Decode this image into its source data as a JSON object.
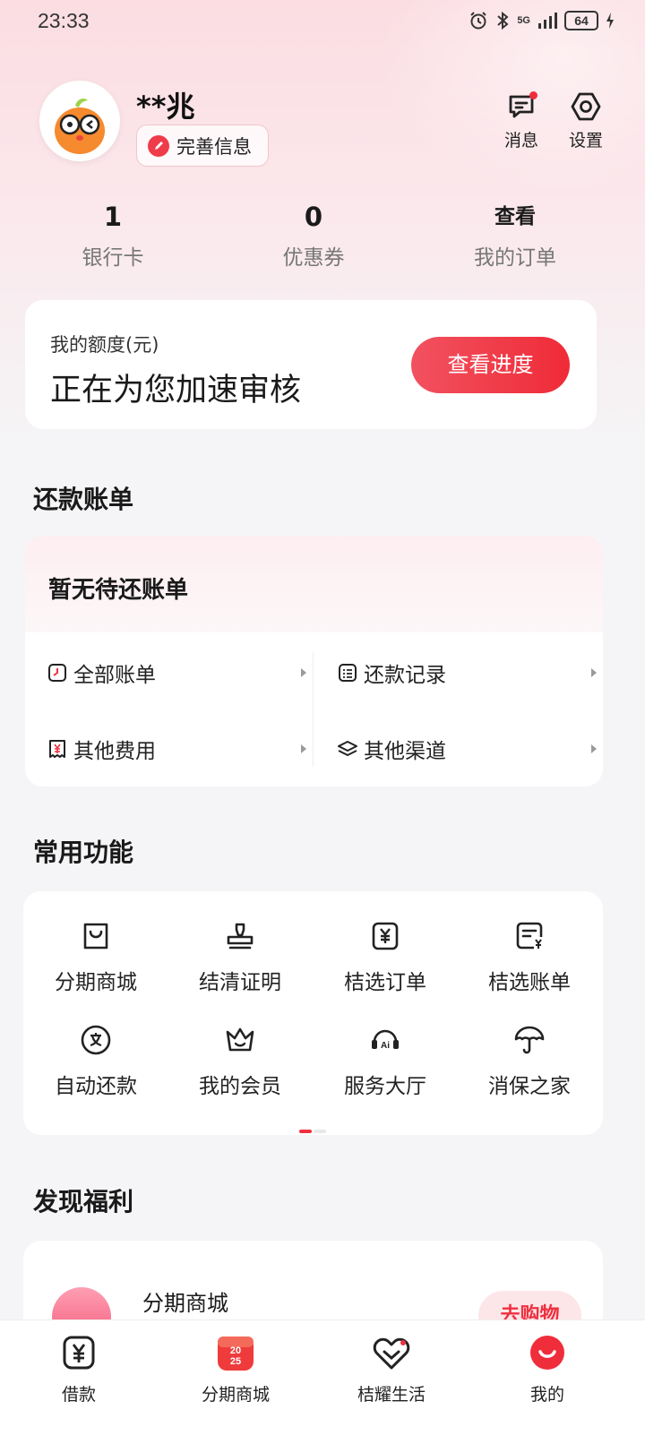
{
  "status_bar": {
    "time": "23:33",
    "signal": "5G",
    "battery": "64"
  },
  "profile": {
    "name": "**兆",
    "complete_info_label": "完善信息"
  },
  "top_actions": {
    "messages_label": "消息",
    "settings_label": "设置"
  },
  "stats": [
    {
      "value": "1",
      "label": "银行卡"
    },
    {
      "value": "0",
      "label": "优惠券"
    },
    {
      "value": "查看",
      "label": "我的订单"
    }
  ],
  "credit": {
    "label": "我的额度(元)",
    "status": "正在为您加速审核",
    "button_label": "查看进度"
  },
  "bills": {
    "section_title": "还款账单",
    "empty_text": "暂无待还账单",
    "links": [
      {
        "label": "全部账单",
        "icon": "bill-clock-icon"
      },
      {
        "label": "还款记录",
        "icon": "list-icon"
      },
      {
        "label": "其他费用",
        "icon": "yen-receipt-icon"
      },
      {
        "label": "其他渠道",
        "icon": "layers-icon"
      }
    ]
  },
  "functions": {
    "section_title": "常用功能",
    "items": [
      {
        "label": "分期商城",
        "icon": "shopping-bag-icon"
      },
      {
        "label": "结清证明",
        "icon": "stamp-icon"
      },
      {
        "label": "桔选订单",
        "icon": "yen-order-icon"
      },
      {
        "label": "桔选账单",
        "icon": "yen-bill-icon"
      },
      {
        "label": "自动还款",
        "icon": "auto-repay-icon"
      },
      {
        "label": "我的会员",
        "icon": "crown-icon"
      },
      {
        "label": "服务大厅",
        "icon": "ai-service-icon"
      },
      {
        "label": "消保之家",
        "icon": "umbrella-icon"
      }
    ]
  },
  "welfare": {
    "section_title": "发现福利",
    "item_name": "分期商城",
    "button_label": "去购物"
  },
  "bottom_nav": [
    {
      "label": "借款",
      "icon": "yen-loan-icon"
    },
    {
      "label": "分期商城",
      "icon": "mall-2025-icon"
    },
    {
      "label": "桔耀生活",
      "icon": "heart-life-icon"
    },
    {
      "label": "我的",
      "icon": "me-icon",
      "active": true
    }
  ],
  "colors": {
    "accent": "#ef3040",
    "background": "#f5f5f7"
  }
}
